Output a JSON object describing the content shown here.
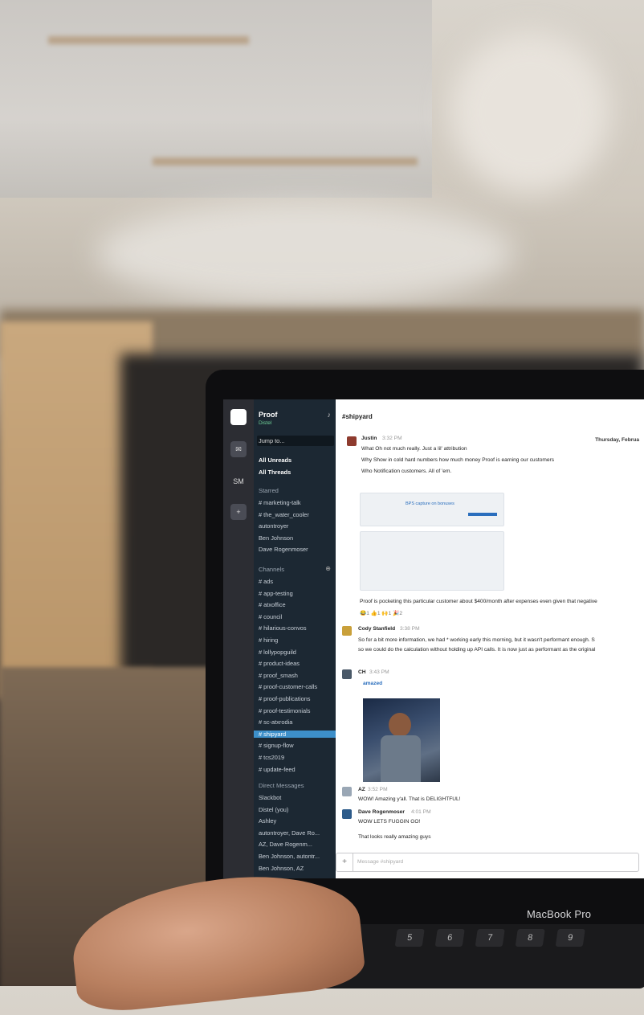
{
  "workspace": {
    "name": "Proof",
    "status": "Distel",
    "jump_to": "Jump to...",
    "rail_initials": "SM"
  },
  "sidebar": {
    "all_unreads": "All Unreads",
    "all_threads": "All Threads",
    "starred_heading": "Starred",
    "starred": [
      "# marketing-talk",
      "# the_water_cooler",
      "autontroyer",
      "Ben Johnson",
      "Dave Rogenmoser"
    ],
    "channels_heading": "Channels",
    "channels": [
      "# ads",
      "# app-testing",
      "# atxoffice",
      "# council",
      "# hilarious-convos",
      "# hiring",
      "# lollypopguild",
      "# product-ideas",
      "# proof_smash",
      "# proof-customer-calls",
      "# proof-publications",
      "# proof-testimonials",
      "# sc-atxrodia",
      "# shipyard",
      "# signup-flow",
      "# tcs2019",
      "# update-feed"
    ],
    "active_channel_index": 13,
    "dm_heading": "Direct Messages",
    "dms": [
      "Slackbot",
      "Distel (you)",
      "Ashley",
      "autontroyer, Dave Ro...",
      "AZ, Dave Rogenm...",
      "Ben Johnson, autontr...",
      "Ben Johnson, AZ"
    ]
  },
  "channel": {
    "name": "#shipyard",
    "date_divider": "Thursday, Februa",
    "messages": [
      {
        "author": "Justin",
        "time": "3:32 PM",
        "lines": [
          "What Oh not much really. Just a lil' attribution",
          "Why Show in cold hard numbers how much money Proof is earning our customers",
          "Who Notification customers. All of 'em."
        ]
      },
      {
        "author": "",
        "time": "",
        "lines": [
          "Proof is pocketing this particular customer about $400/month after expenses even given that negative"
        ]
      },
      {
        "author": "Cody Stanfield",
        "time": "3:38 PM",
        "lines": [
          "So for a bit more information, we had * working early this morning, but it wasn't performant enough. S",
          "so we could do the calculation without holding up API calls. It is now just as performant as the original"
        ]
      },
      {
        "author": "CH",
        "time": "3:43 PM",
        "lines": [
          "amazed"
        ]
      },
      {
        "author": "AZ",
        "time": "3:52 PM",
        "lines": [
          "WOW! Amazing y'all. That is DELIGHTFUL!"
        ]
      },
      {
        "author": "Dave Rogenmoser",
        "time": "4:01 PM",
        "lines": [
          "WOW LETS FUGGIN GO!",
          "That looks really amazing guys"
        ]
      }
    ],
    "card_title": "BPS capture on bonuses",
    "composer_placeholder": "Message #shipyard"
  },
  "device": {
    "brand": "MacBook Pro"
  },
  "keys": [
    "5",
    "6",
    "7",
    "8",
    "9"
  ]
}
